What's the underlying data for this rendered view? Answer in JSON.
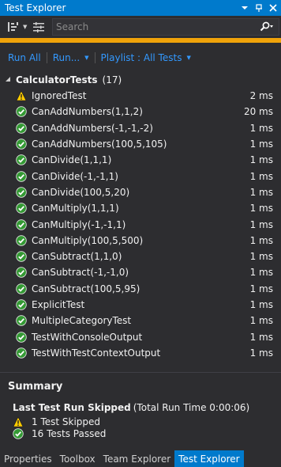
{
  "window": {
    "title": "Test Explorer"
  },
  "toolbar": {
    "group_icon": "group-by-icon",
    "options_icon": "options-icon",
    "search_placeholder": "Search",
    "search_icon": "search-icon"
  },
  "actions": {
    "run_all": "Run All",
    "run": "Run...",
    "playlist": "Playlist : All Tests"
  },
  "group": {
    "name": "CalculatorTests",
    "count": "(17)"
  },
  "tests": [
    {
      "name": "IgnoredTest",
      "duration": "2 ms",
      "status": "skipped"
    },
    {
      "name": "CanAddNumbers(1,1,2)",
      "duration": "20 ms",
      "status": "passed"
    },
    {
      "name": "CanAddNumbers(-1,-1,-2)",
      "duration": "1 ms",
      "status": "passed"
    },
    {
      "name": "CanAddNumbers(100,5,105)",
      "duration": "1 ms",
      "status": "passed"
    },
    {
      "name": "CanDivide(1,1,1)",
      "duration": "1 ms",
      "status": "passed"
    },
    {
      "name": "CanDivide(-1,-1,1)",
      "duration": "1 ms",
      "status": "passed"
    },
    {
      "name": "CanDivide(100,5,20)",
      "duration": "1 ms",
      "status": "passed"
    },
    {
      "name": "CanMultiply(1,1,1)",
      "duration": "1 ms",
      "status": "passed"
    },
    {
      "name": "CanMultiply(-1,-1,1)",
      "duration": "1 ms",
      "status": "passed"
    },
    {
      "name": "CanMultiply(100,5,500)",
      "duration": "1 ms",
      "status": "passed"
    },
    {
      "name": "CanSubtract(1,1,0)",
      "duration": "1 ms",
      "status": "passed"
    },
    {
      "name": "CanSubtract(-1,-1,0)",
      "duration": "1 ms",
      "status": "passed"
    },
    {
      "name": "CanSubtract(100,5,95)",
      "duration": "1 ms",
      "status": "passed"
    },
    {
      "name": "ExplicitTest",
      "duration": "1 ms",
      "status": "passed"
    },
    {
      "name": "MultipleCategoryTest",
      "duration": "1 ms",
      "status": "passed"
    },
    {
      "name": "TestWithConsoleOutput",
      "duration": "1 ms",
      "status": "passed"
    },
    {
      "name": "TestWithTestContextOutput",
      "duration": "1 ms",
      "status": "passed"
    }
  ],
  "summary": {
    "title": "Summary",
    "last_run_label": "Last Test Run Skipped",
    "last_run_time": "(Total Run Time 0:00:06)",
    "skipped": "1 Test Skipped",
    "passed": "16 Tests Passed"
  },
  "tabs": [
    {
      "label": "Properties",
      "active": false
    },
    {
      "label": "Toolbox",
      "active": false
    },
    {
      "label": "Team Explorer",
      "active": false
    },
    {
      "label": "Test Explorer",
      "active": true
    }
  ],
  "colors": {
    "accent": "#007acc",
    "progress": "#f0a30a",
    "link": "#3399ff",
    "pass": "#339933",
    "warn": "#ffcc00"
  }
}
